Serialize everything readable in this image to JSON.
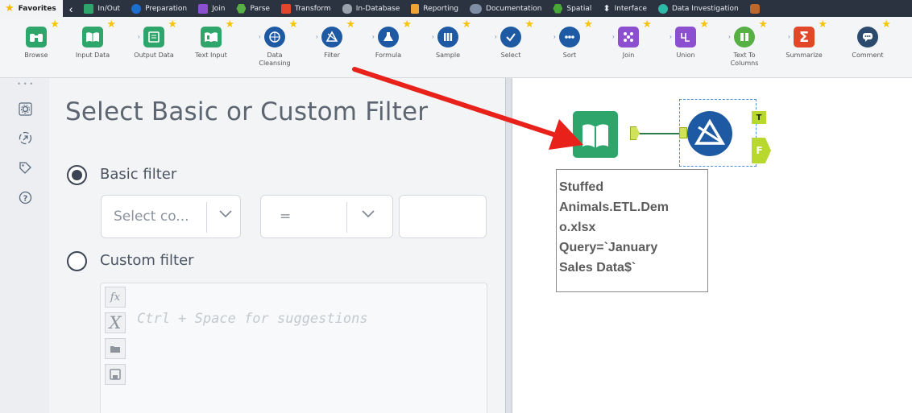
{
  "tabbar": {
    "tabs": [
      {
        "label": "Favorites",
        "icon": "star-icon",
        "color": "#f6b800"
      },
      {
        "label": "In/Out",
        "icon": "folder-icon",
        "color": "#2ea56a"
      },
      {
        "label": "Preparation",
        "icon": "circle-icon",
        "color": "#1c6fd0"
      },
      {
        "label": "Join",
        "icon": "square-icon",
        "color": "#8c4fd0"
      },
      {
        "label": "Parse",
        "icon": "hexagon-icon",
        "color": "#56b044"
      },
      {
        "label": "Transform",
        "icon": "square-icon",
        "color": "#e2472a"
      },
      {
        "label": "In-Database",
        "icon": "database-icon",
        "color": "#9aa2ad"
      },
      {
        "label": "Reporting",
        "icon": "document-icon",
        "color": "#f0a431"
      },
      {
        "label": "Documentation",
        "icon": "cloud-icon",
        "color": "#7f8ea4"
      },
      {
        "label": "Spatial",
        "icon": "globe-icon",
        "color": "#4aa838"
      },
      {
        "label": "Interface",
        "icon": "arrows-icon",
        "color": "#ffffff"
      },
      {
        "label": "Data Investigation",
        "icon": "circle-icon",
        "color": "#2eb8a6"
      }
    ]
  },
  "palette": {
    "tools": [
      {
        "label": "Browse",
        "icon": "binoculars-icon",
        "color": "#2ea56a"
      },
      {
        "label": "Input Data",
        "icon": "book-icon",
        "color": "#2ea56a"
      },
      {
        "label": "Output Data",
        "icon": "document-edit-icon",
        "color": "#2ea56a"
      },
      {
        "label": "Text Input",
        "icon": "book-icon",
        "color": "#2ea56a"
      },
      {
        "label": "Data\nCleansing",
        "icon": "globe-grid-icon",
        "color": "#1e5aa3"
      },
      {
        "label": "Filter",
        "icon": "filter-prism-icon",
        "color": "#1e5aa3"
      },
      {
        "label": "Formula",
        "icon": "flask-icon",
        "color": "#1e5aa3"
      },
      {
        "label": "Sample",
        "icon": "columns-icon",
        "color": "#1e5aa3"
      },
      {
        "label": "Select",
        "icon": "check-list-icon",
        "color": "#1e5aa3"
      },
      {
        "label": "Sort",
        "icon": "dots-icon",
        "color": "#1e5aa3"
      },
      {
        "label": "Join",
        "icon": "join-icon",
        "color": "#8c4fd0"
      },
      {
        "label": "Union",
        "icon": "union-icon",
        "color": "#8c4fd0"
      },
      {
        "label": "Text To\nColumns",
        "icon": "text-columns-icon",
        "color": "#56b044"
      },
      {
        "label": "Summarize",
        "icon": "sigma-icon",
        "color": "#e2472a"
      },
      {
        "label": "Comment",
        "icon": "speech-bubble-icon",
        "color": "#2c4a6e"
      }
    ]
  },
  "panel": {
    "title": "Select Basic or Custom Filter",
    "basic_filter_label": "Basic filter",
    "basic_filter_selected": true,
    "column_select_text": "Select co...",
    "operator_text": "=",
    "value_text": "",
    "custom_filter_label": "Custom filter",
    "custom_filter_selected": false,
    "editor_placeholder": "Ctrl + Space for suggestions",
    "editor_buttons": [
      "fx",
      "X"
    ]
  },
  "canvas": {
    "true_anchor": "T",
    "false_anchor": "F",
    "annotation_lines": [
      "Stuffed",
      "Animals.ETL.Dem",
      "o.xlsx",
      "Query=`January",
      "Sales Data$`"
    ]
  },
  "colors": {
    "accent_arrow": "#e8211a",
    "input_green": "#2ea56a",
    "filter_blue": "#1e5aa3",
    "anchor_yellow_green": "#b9d82d"
  }
}
